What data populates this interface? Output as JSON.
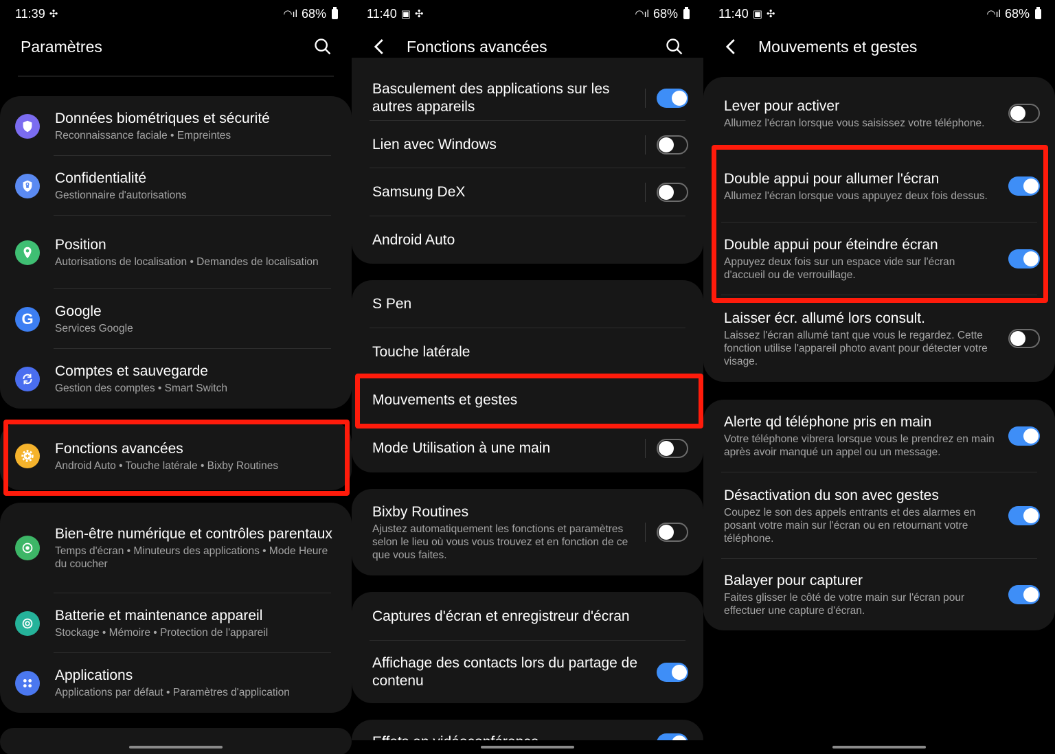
{
  "colors": {
    "toggle_on": "#3e8ef7",
    "highlight": "#ff1b0b",
    "card_bg": "#171717"
  },
  "panels": [
    {
      "status": {
        "time": "11:39",
        "battery": "68%"
      },
      "header": {
        "title": "Paramètres"
      },
      "items": [
        {
          "title": "Données biométriques et sécurité",
          "subtitle": "Reconnaissance faciale  •  Empreintes",
          "icon": "shield-icon",
          "color": "#7b6cf0"
        },
        {
          "title": "Confidentialité",
          "subtitle": "Gestionnaire d'autorisations",
          "icon": "privacy-shield-icon",
          "color": "#5b8af2"
        },
        {
          "title": "Position",
          "subtitle": "Autorisations de localisation  •  Demandes de localisation",
          "icon": "location-pin-icon",
          "color": "#3fbf73"
        },
        {
          "title": "Google",
          "subtitle": "Services Google",
          "icon": "google-icon",
          "color": "#3d7ff3"
        },
        {
          "title": "Comptes et sauvegarde",
          "subtitle": "Gestion des comptes  •  Smart Switch",
          "icon": "sync-icon",
          "color": "#4a6ef0"
        },
        {
          "title": "Fonctions avancées",
          "subtitle": "Android Auto  •  Touche latérale  •  Bixby Routines",
          "icon": "gear-plus-icon",
          "color": "#f5b32c"
        },
        {
          "title": "Bien-être numérique et contrôles parentaux",
          "subtitle": "Temps d'écran  •  Minuteurs des applications  •  Mode Heure du coucher",
          "icon": "wellbeing-icon",
          "color": "#3db667"
        },
        {
          "title": "Batterie et maintenance appareil",
          "subtitle": "Stockage  •  Mémoire  •  Protection de l'appareil",
          "icon": "battery-care-icon",
          "color": "#25b39a"
        },
        {
          "title": "Applications",
          "subtitle": "Applications par défaut  •  Paramètres d'application",
          "icon": "apps-grid-icon",
          "color": "#4b78f0"
        }
      ]
    },
    {
      "status": {
        "time": "11:40",
        "battery": "68%"
      },
      "header": {
        "title": "Fonctions avancées"
      },
      "items": [
        {
          "title": "Basculement des applications sur les autres appareils",
          "toggle": true
        },
        {
          "title": "Lien avec Windows",
          "toggle": false
        },
        {
          "title": "Samsung DeX",
          "toggle": false
        },
        {
          "title": "Android Auto"
        },
        {
          "title": "S Pen"
        },
        {
          "title": "Touche latérale"
        },
        {
          "title": "Mouvements et gestes"
        },
        {
          "title": "Mode Utilisation à une main",
          "toggle": false
        },
        {
          "title": "Bixby Routines",
          "subtitle": "Ajustez automatiquement les fonctions et paramètres selon le lieu où vous vous trouvez et en fonction de ce que vous faites.",
          "toggle": false
        },
        {
          "title": "Captures d'écran et enregistreur d'écran"
        },
        {
          "title": "Affichage des contacts lors du partage de contenu",
          "toggle": true
        },
        {
          "title": "Effets en vidéoconférence",
          "toggle": true
        }
      ]
    },
    {
      "status": {
        "time": "11:40",
        "battery": "68%"
      },
      "header": {
        "title": "Mouvements et gestes"
      },
      "items": [
        {
          "title": "Lever pour activer",
          "subtitle": "Allumez l'écran lorsque vous saisissez votre téléphone.",
          "toggle": false
        },
        {
          "title": "Double appui pour allumer l'écran",
          "subtitle": "Allumez l'écran lorsque vous appuyez deux fois dessus.",
          "toggle": true
        },
        {
          "title": "Double appui pour éteindre écran",
          "subtitle": "Appuyez deux fois sur un espace vide sur l'écran d'accueil ou de verrouillage.",
          "toggle": true
        },
        {
          "title": "Laisser écr. allumé lors consult.",
          "subtitle": "Laissez l'écran allumé tant que vous le regardez. Cette fonction utilise l'appareil photo avant pour détecter votre visage.",
          "toggle": false
        },
        {
          "title": "Alerte qd téléphone pris en main",
          "subtitle": "Votre téléphone vibrera lorsque vous le prendrez en main après avoir manqué un appel ou un message.",
          "toggle": true
        },
        {
          "title": "Désactivation du son avec gestes",
          "subtitle": "Coupez le son des appels entrants et des alarmes en posant votre main sur l'écran ou en retournant votre téléphone.",
          "toggle": true
        },
        {
          "title": "Balayer pour capturer",
          "subtitle": "Faites glisser le côté de votre main sur l'écran pour effectuer une capture d'écran.",
          "toggle": true
        }
      ]
    }
  ]
}
